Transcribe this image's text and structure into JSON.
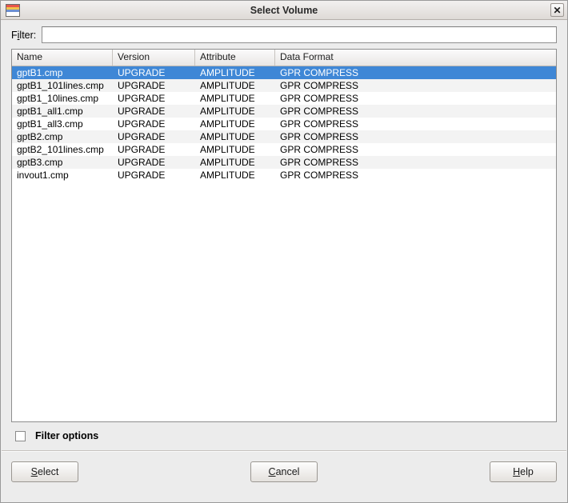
{
  "window": {
    "title": "Select Volume",
    "icon": "app-stripes-icon",
    "close_label": "✕"
  },
  "filter": {
    "label_prefix": "F",
    "label_underlined": "i",
    "label_suffix": "lter:",
    "label_full": "Filter:",
    "value": "",
    "placeholder": ""
  },
  "table": {
    "columns": [
      "Name",
      "Version",
      "Attribute",
      "Data Format"
    ],
    "rows": [
      {
        "name": "gptB1.cmp",
        "version": "UPGRADE",
        "attribute": "AMPLITUDE",
        "format": "GPR COMPRESS",
        "selected": true
      },
      {
        "name": "gptB1_101lines.cmp",
        "version": "UPGRADE",
        "attribute": "AMPLITUDE",
        "format": "GPR COMPRESS",
        "selected": false
      },
      {
        "name": "gptB1_10lines.cmp",
        "version": "UPGRADE",
        "attribute": "AMPLITUDE",
        "format": "GPR COMPRESS",
        "selected": false
      },
      {
        "name": "gptB1_all1.cmp",
        "version": "UPGRADE",
        "attribute": "AMPLITUDE",
        "format": "GPR COMPRESS",
        "selected": false
      },
      {
        "name": "gptB1_all3.cmp",
        "version": "UPGRADE",
        "attribute": "AMPLITUDE",
        "format": "GPR COMPRESS",
        "selected": false
      },
      {
        "name": "gptB2.cmp",
        "version": "UPGRADE",
        "attribute": "AMPLITUDE",
        "format": "GPR COMPRESS",
        "selected": false
      },
      {
        "name": "gptB2_101lines.cmp",
        "version": "UPGRADE",
        "attribute": "AMPLITUDE",
        "format": "GPR COMPRESS",
        "selected": false
      },
      {
        "name": "gptB3.cmp",
        "version": "UPGRADE",
        "attribute": "AMPLITUDE",
        "format": "GPR COMPRESS",
        "selected": false
      },
      {
        "name": "invout1.cmp",
        "version": "UPGRADE",
        "attribute": "AMPLITUDE",
        "format": "GPR COMPRESS",
        "selected": false
      }
    ]
  },
  "filter_options": {
    "label": "Filter options",
    "checked": false
  },
  "buttons": {
    "select": {
      "prefix": "",
      "underlined": "S",
      "suffix": "elect",
      "label": "Select"
    },
    "cancel": {
      "prefix": "",
      "underlined": "C",
      "suffix": "ancel",
      "label": "Cancel"
    },
    "help": {
      "prefix": "",
      "underlined": "H",
      "suffix": "elp",
      "label": "Help"
    }
  },
  "colors": {
    "selection": "#3f87d6",
    "window_bg": "#ececec",
    "alt_row": "#f3f3f3"
  }
}
